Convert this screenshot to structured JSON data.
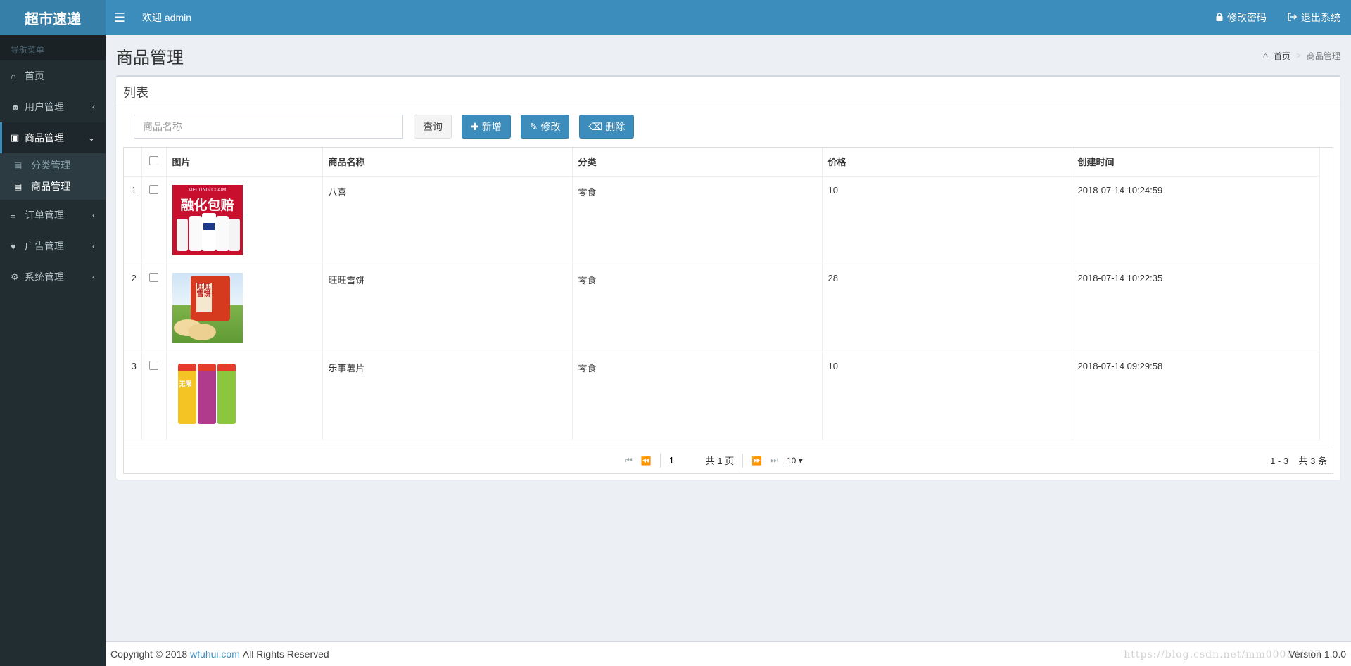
{
  "app": {
    "logo": "超市速递",
    "welcome": "欢迎 admin"
  },
  "header_links": {
    "change_password": "修改密码",
    "logout": "退出系统"
  },
  "sidebar": {
    "header": "导航菜单",
    "items": [
      {
        "label": "首页",
        "icon": "home-icon"
      },
      {
        "label": "用户管理",
        "icon": "user-icon"
      },
      {
        "label": "商品管理",
        "icon": "cart-icon"
      },
      {
        "label": "订单管理",
        "icon": "list-icon"
      },
      {
        "label": "广告管理",
        "icon": "heart-icon"
      },
      {
        "label": "系统管理",
        "icon": "gear-icon"
      }
    ],
    "submenu": [
      {
        "label": "分类管理"
      },
      {
        "label": "商品管理"
      }
    ]
  },
  "page": {
    "title": "商品管理",
    "breadcrumb": {
      "home": "首页",
      "current": "商品管理",
      "separator": ">"
    }
  },
  "box": {
    "title": "列表"
  },
  "toolbar": {
    "search_placeholder": "商品名称",
    "query": "查询",
    "add": "新增",
    "edit": "修改",
    "delete": "删除"
  },
  "table": {
    "headers": {
      "image": "图片",
      "name": "商品名称",
      "category": "分类",
      "price": "价格",
      "created": "创建时间"
    },
    "rows": [
      {
        "index": "1",
        "name": "八喜",
        "category": "零食",
        "price": "10",
        "created": "2018-07-14 10:24:59",
        "thumb_text": "融化包赔"
      },
      {
        "index": "2",
        "name": "旺旺雪饼",
        "category": "零食",
        "price": "28",
        "created": "2018-07-14 10:22:35",
        "thumb_text": "旺旺雪饼"
      },
      {
        "index": "3",
        "name": "乐事薯片",
        "category": "零食",
        "price": "10",
        "created": "2018-07-14 09:29:58",
        "thumb_text": "无限"
      }
    ]
  },
  "pager": {
    "page": "1",
    "total_pages": "共 1 页",
    "page_size": "10",
    "range": "1 - 3",
    "total": "共 3 条"
  },
  "footer": {
    "copyright": "Copyright © 2018",
    "link": "wfuhui.com",
    "rights": "All Rights Reserved",
    "version": "Version 1.0.0"
  },
  "watermark": "https://blog.csdn.net/mm00084067",
  "colors": {
    "header": "#3c8dbc",
    "logo_bg": "#367fa9",
    "sidebar": "#222d32",
    "primary": "#3c8dbc"
  }
}
